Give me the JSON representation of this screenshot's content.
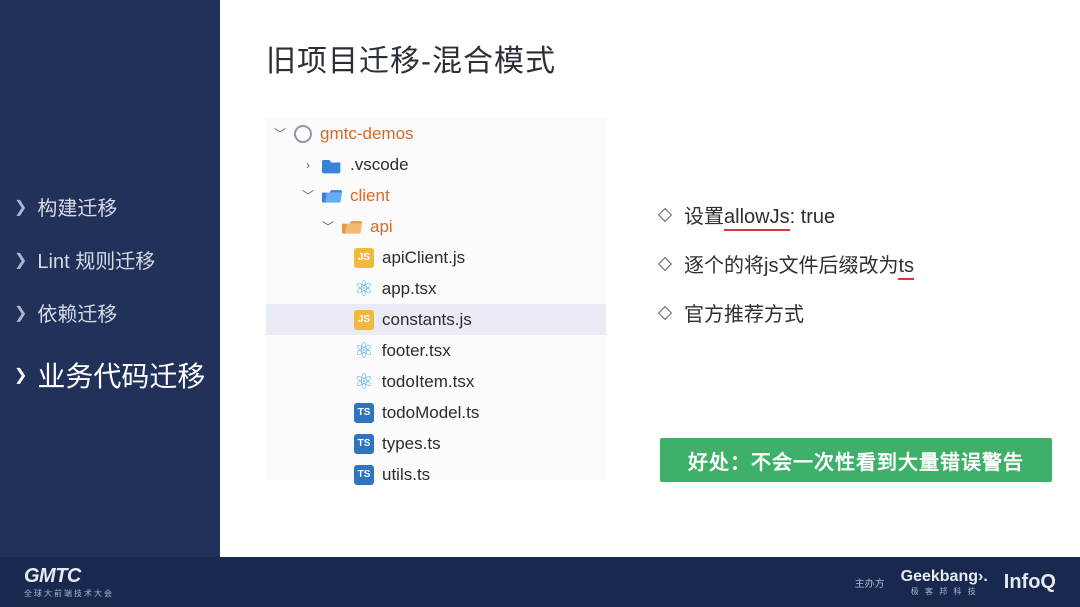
{
  "sidebar": {
    "items": [
      {
        "label": "构建迁移"
      },
      {
        "label": "Lint 规则迁移"
      },
      {
        "label": "依赖迁移"
      },
      {
        "label": "业务代码迁移"
      }
    ]
  },
  "title": "旧项目迁移-混合模式",
  "tree": {
    "root": "gmtc-demos",
    "vscode": ".vscode",
    "client": "client",
    "api": "api",
    "files": {
      "apiClient": "apiClient.js",
      "app": "app.tsx",
      "constants": "constants.js",
      "footer": "footer.tsx",
      "todoItem": "todoItem.tsx",
      "todoModel": "todoModel.ts",
      "types": "types.ts",
      "utils": "utils.ts"
    }
  },
  "bullets": {
    "b1_pre": "设置",
    "b1_allow": "allowJs",
    "b1_post": ": true",
    "b2_pre": "逐个的将js文件后缀改为",
    "b2_ts": "ts",
    "b3": "官方推荐方式"
  },
  "benefit": "好处：不会一次性看到大量错误警告",
  "footer": {
    "logo": "GMTC",
    "logo_sub": "全球大前端技术大会",
    "host": "主办方",
    "geek": "Geekbang›.",
    "geek_sub": "极 客 邦 科 技",
    "infoq": "InfoQ"
  },
  "icons": {
    "ts": "TS",
    "js": "JS"
  }
}
